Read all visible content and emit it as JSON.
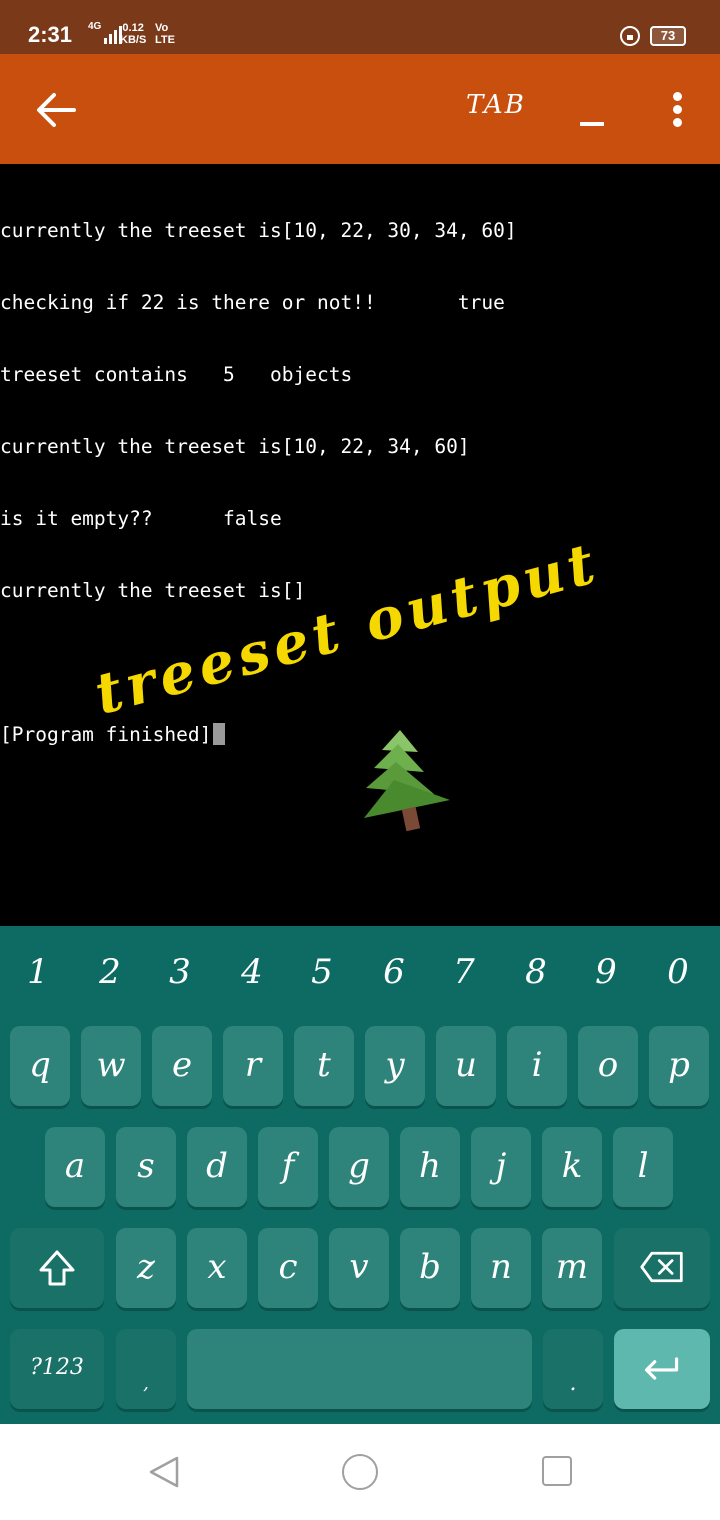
{
  "status_bar": {
    "time": "2:31",
    "network": "4G",
    "speed_value": "0.12",
    "speed_unit": "KB/S",
    "volte_top": "Vo",
    "volte_bottom": "LTE",
    "battery": "73"
  },
  "app_bar": {
    "tab_label": "TAB"
  },
  "terminal": {
    "lines": [
      "currently the treeset is[10, 22, 30, 34, 60]",
      "checking if 22 is there or not!!       true",
      "treeset contains   5   objects",
      "currently the treeset is[10, 22, 34, 60]",
      "is it empty??      false",
      "currently the treeset is[]",
      "",
      "[Program finished]"
    ],
    "overlay_text": "treeset output",
    "sticker_icon": "evergreen-tree-icon"
  },
  "keyboard": {
    "number_row": [
      "1",
      "2",
      "3",
      "4",
      "5",
      "6",
      "7",
      "8",
      "9",
      "0"
    ],
    "row1": [
      "q",
      "w",
      "e",
      "r",
      "t",
      "y",
      "u",
      "i",
      "o",
      "p"
    ],
    "row2": [
      "a",
      "s",
      "d",
      "f",
      "g",
      "h",
      "j",
      "k",
      "l"
    ],
    "row3": [
      "z",
      "x",
      "c",
      "v",
      "b",
      "n",
      "m"
    ],
    "symbols_key": "?123",
    "comma_key": ",",
    "period_key": "."
  },
  "colors": {
    "status_bar": "#7a3a1a",
    "app_bar": "#c94f0f",
    "terminal_bg": "#000000",
    "overlay_text": "#f5d800",
    "keyboard_bg": "#0d6b63",
    "key_bg": "#2e847a",
    "enter_key": "#5fb8ad"
  }
}
